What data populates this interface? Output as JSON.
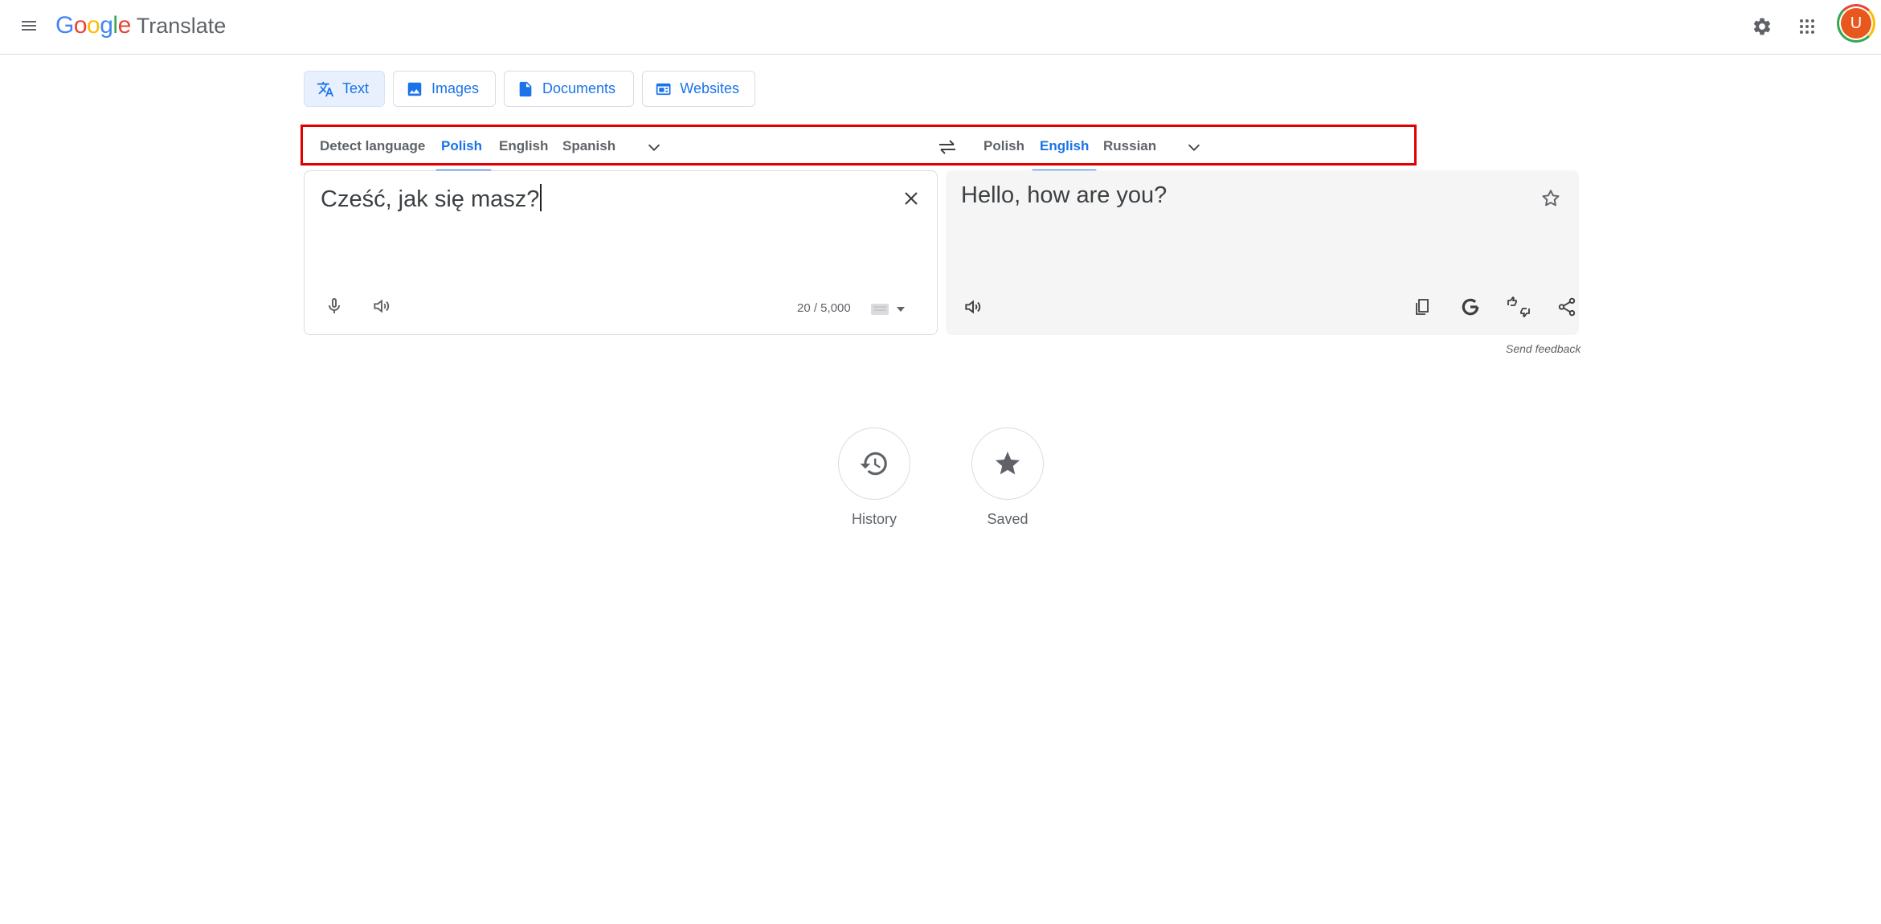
{
  "header": {
    "logo_letters": [
      {
        "char": "G",
        "color": "#4285f4"
      },
      {
        "char": "o",
        "color": "#ea4335"
      },
      {
        "char": "o",
        "color": "#fbbc04"
      },
      {
        "char": "g",
        "color": "#4285f4"
      },
      {
        "char": "l",
        "color": "#34a853"
      },
      {
        "char": "e",
        "color": "#ea4335"
      }
    ],
    "product_name": "Translate",
    "avatar_initial": "U",
    "icons": [
      "menu-icon",
      "settings-gear-icon",
      "apps-grid-icon"
    ]
  },
  "mode_tabs": [
    {
      "label": "Text",
      "icon": "translate-icon",
      "active": true
    },
    {
      "label": "Images",
      "icon": "image-icon",
      "active": false
    },
    {
      "label": "Documents",
      "icon": "document-icon",
      "active": false
    },
    {
      "label": "Websites",
      "icon": "website-icon",
      "active": false
    }
  ],
  "source_languages": {
    "detect": "Detect language",
    "options": [
      "Polish",
      "English",
      "Spanish"
    ],
    "selected": "Polish"
  },
  "target_languages": {
    "options": [
      "Polish",
      "English",
      "Russian"
    ],
    "selected": "English"
  },
  "source": {
    "text": "Cześć, jak się masz?",
    "char_count": "20 / 5,000"
  },
  "target": {
    "text": "Hello, how are you?"
  },
  "send_feedback": "Send feedback",
  "shortcuts": {
    "history": "History",
    "saved": "Saved"
  },
  "colors": {
    "accent": "#1a73e8",
    "highlight_box": "#e00000",
    "target_bg": "#f5f5f5"
  }
}
